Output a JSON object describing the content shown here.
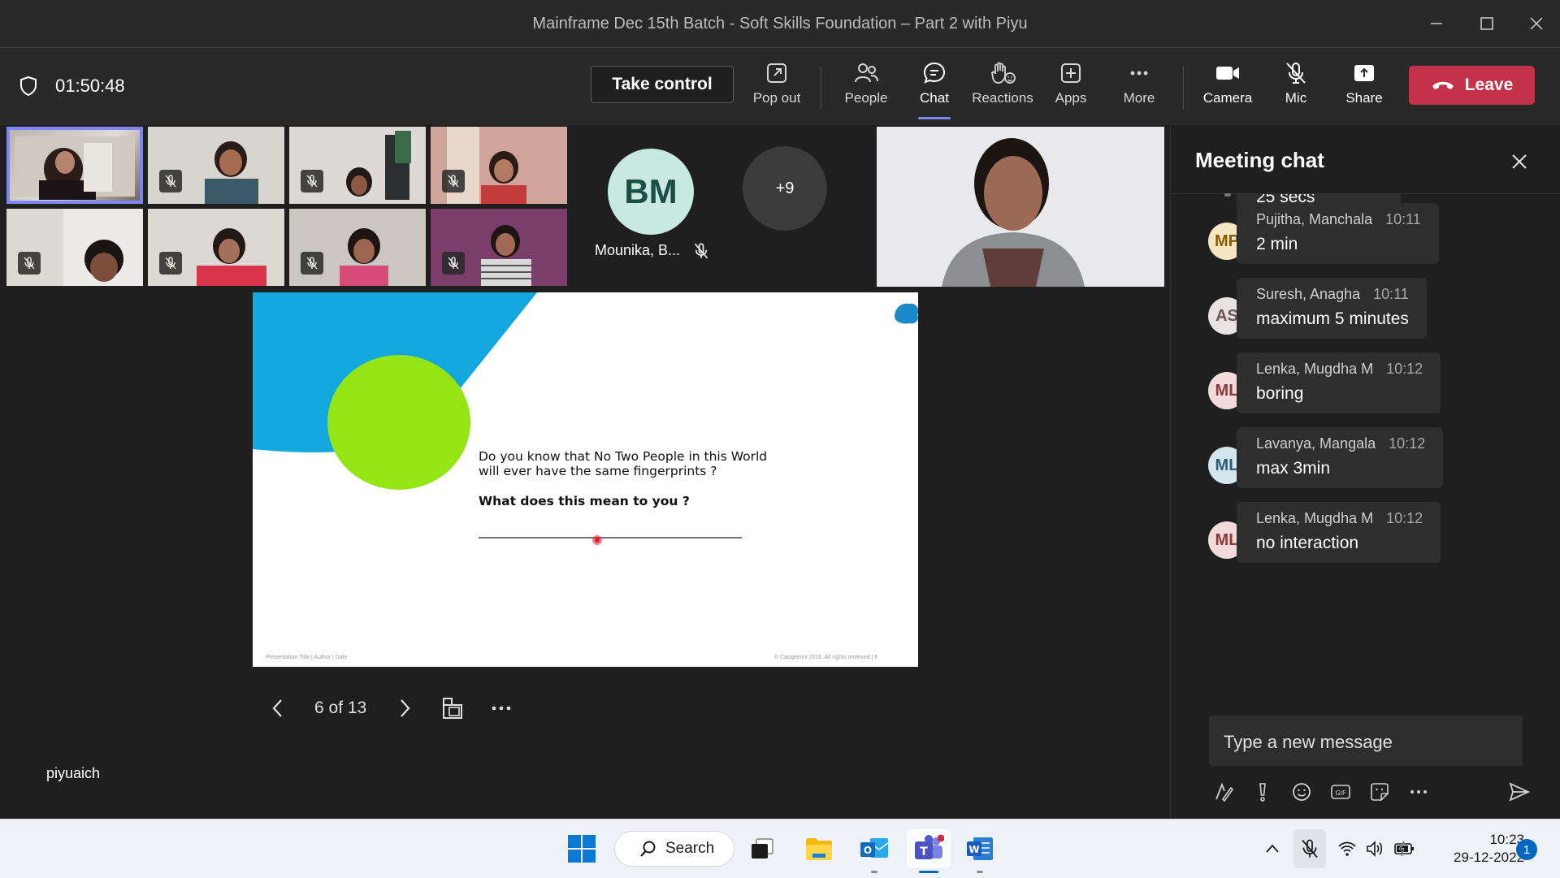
{
  "window": {
    "title": "Mainframe Dec 15th Batch - Soft Skills Foundation – Part 2 with Piyu"
  },
  "toolbar": {
    "timer": "01:50:48",
    "take_control": "Take control",
    "pop_out": "Pop out",
    "people": "People",
    "chat": "Chat",
    "reactions": "Reactions",
    "apps": "Apps",
    "more": "More",
    "camera": "Camera",
    "mic": "Mic",
    "share": "Share",
    "leave": "Leave"
  },
  "participants": {
    "bm_initials": "BM",
    "bm_name": "Mounika, B...",
    "overflow": "+9",
    "presenter": "piyuaich"
  },
  "slide": {
    "question_line1": "Do you know that No Two People in this World",
    "question_line2": "will ever have the same fingerprints ?",
    "prompt": "What does this mean to you ?",
    "footer_left": "Presentation Title | Author | Date",
    "footer_right": "© Capgemini 2016. All rights reserved  |   6",
    "page": "6 of 13"
  },
  "chat": {
    "title": "Meeting chat",
    "clipped_text": "25 secs",
    "messages": [
      {
        "initials": "MP",
        "name": "Pujitha, Manchala",
        "time": "10:11",
        "text": "2 min",
        "bg": "#f6e6c2",
        "fg": "#8a5a00"
      },
      {
        "initials": "AS",
        "name": "Suresh, Anagha",
        "time": "10:11",
        "text": "maximum 5 minutes",
        "bg": "#e8e2e2",
        "fg": "#6b5454"
      },
      {
        "initials": "ML",
        "name": "Lenka, Mugdha M",
        "time": "10:12",
        "text": "boring",
        "bg": "#f3dada",
        "fg": "#8c3a3a"
      },
      {
        "initials": "ML",
        "name": "Lavanya, Mangala",
        "time": "10:12",
        "text": "max 3min",
        "bg": "#d6e6ee",
        "fg": "#2f5b70"
      },
      {
        "initials": "ML",
        "name": "Lenka, Mugdha M",
        "time": "10:12",
        "text": "no interaction",
        "bg": "#f3dada",
        "fg": "#8c3a3a"
      }
    ],
    "compose_placeholder": "Type a new message"
  },
  "taskbar": {
    "search": "Search",
    "time": "10:23",
    "date": "29-12-2022",
    "notifications": "1"
  },
  "colors": {
    "accent": "#7f85f5",
    "leave": "#c4314b",
    "slide_blue": "#12a8de",
    "slide_green": "#95e414"
  }
}
